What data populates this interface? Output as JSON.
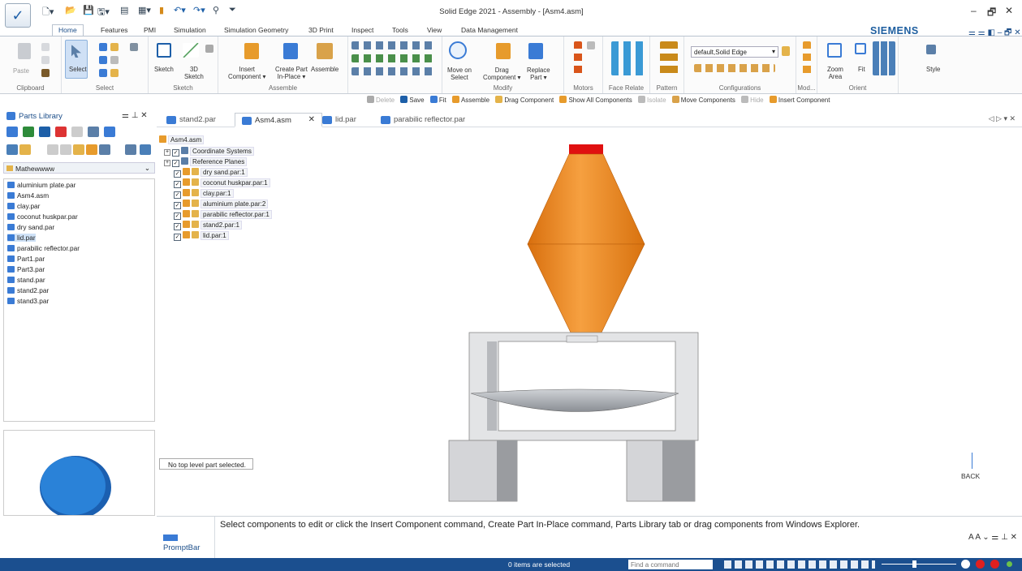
{
  "window": {
    "title": "Solid Edge 2021 - Assembly - [Asm4.asm]"
  },
  "brand": "SIEMENS",
  "ribbon_tabs": [
    "Home",
    "Features",
    "PMI",
    "Simulation",
    "Simulation Geometry",
    "3D Print",
    "Inspect",
    "Tools",
    "View",
    "Data Management"
  ],
  "active_tab": "Home",
  "ribbon": {
    "clipboard": {
      "paste": "Paste",
      "label": "Clipboard"
    },
    "select": {
      "select": "Select",
      "label": "Select"
    },
    "sketch": {
      "sketch": "Sketch",
      "sketch3d_1": "3D",
      "sketch3d_2": "Sketch",
      "label": "Sketch"
    },
    "assemble": {
      "insert_1": "Insert",
      "insert_2": "Component",
      "create_1": "Create Part",
      "create_2": "In-Place",
      "assemble": "Assemble",
      "label": "Assemble"
    },
    "modify": {
      "move_1": "Move on",
      "move_2": "Select",
      "drag_1": "Drag",
      "drag_2": "Component",
      "replace_1": "Replace",
      "replace_2": "Part",
      "label": "Modify"
    },
    "motors": {
      "label": "Motors"
    },
    "face_relate": {
      "label": "Face Relate"
    },
    "pattern": {
      "label": "Pattern"
    },
    "configurations": {
      "value": "default,Solid Edge",
      "label": "Configurations"
    },
    "mod": {
      "label": "Mod..."
    },
    "orient": {
      "zoom_1": "Zoom",
      "zoom_2": "Area",
      "fit": "Fit",
      "label": "Orient"
    },
    "style": {
      "style": "Style"
    }
  },
  "command_bar": {
    "delete": "Delete",
    "save": "Save",
    "fit": "Fit",
    "assemble": "Assemble",
    "drag": "Drag Component",
    "show_all": "Show All Components",
    "isolate": "Isolate",
    "move": "Move Components",
    "hide": "Hide",
    "insert": "Insert Component"
  },
  "parts_library": {
    "title": "Parts Library",
    "folder": "Mathewwww",
    "files": [
      "aluminium plate.par",
      "Asm4.asm",
      "clay.par",
      "coconut huskpar.par",
      "dry sand.par",
      "lid.par",
      "parabilic reflector.par",
      "Part1.par",
      "Part3.par",
      "stand.par",
      "stand2.par",
      "stand3.par"
    ],
    "selected": "lid.par"
  },
  "doc_tabs": [
    "stand2.par",
    "Asm4.asm",
    "lid.par",
    "parabilic reflector.par"
  ],
  "active_doc": "Asm4.asm",
  "tree": {
    "root": "Asm4.asm",
    "items": [
      "Coordinate Systems",
      "Reference Planes",
      "dry sand.par:1",
      "coconut huskpar.par:1",
      "clay.par:1",
      "aluminium plate.par:2",
      "parabilic reflector.par:1",
      "stand2.par:1",
      "lid.par:1"
    ]
  },
  "message": "No top level part selected.",
  "prompt": {
    "label": "PromptBar",
    "text": "Select components to edit or click the Insert Component command, Create Part In-Place command, Parts Library tab or drag components from Windows Explorer."
  },
  "status": {
    "selected": "0 items are selected",
    "find_placeholder": "Find a command"
  },
  "view_cube": "BACK",
  "colors": {
    "accent": "#1b4f8f",
    "cone": "#f08a1c",
    "cap": "#e01010",
    "part_blue": "#2a82d8"
  }
}
